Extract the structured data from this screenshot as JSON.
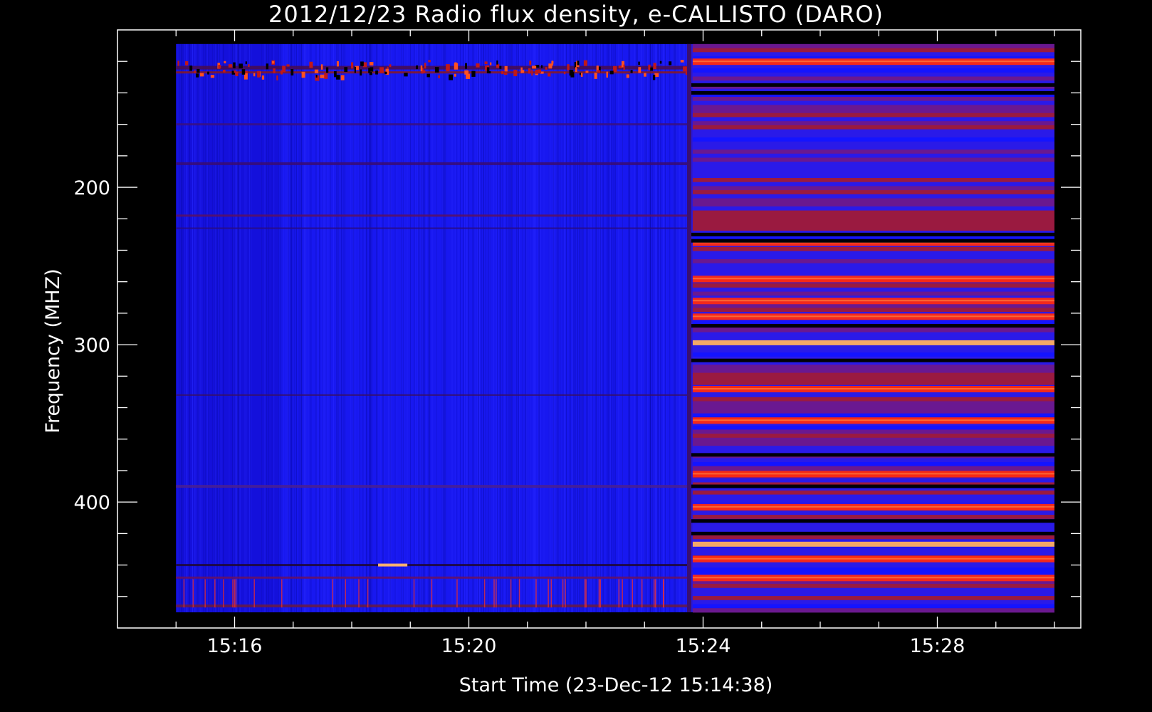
{
  "chart_data": {
    "type": "heatmap",
    "title": "2012/12/23  Radio flux density, e-CALLISTO (DARO)",
    "xlabel": "Start Time (23-Dec-12 15:14:38)",
    "ylabel": "Frequency (MHZ)",
    "x_tick_labels": [
      "15:16",
      "15:20",
      "15:24",
      "15:28"
    ],
    "x_tick_minutes": [
      16,
      20,
      24,
      28
    ],
    "y_tick_labels": [
      "200",
      "300",
      "400"
    ],
    "y_tick_values": [
      200,
      300,
      400
    ],
    "xlim_minutes": [
      14.0,
      30.45
    ],
    "ylim_mhz": [
      100,
      480
    ],
    "data_extent": {
      "time_start_minutes": 15.0,
      "time_end_minutes": 30.0,
      "freq_top_mhz": 109,
      "freq_bottom_mhz": 470
    },
    "event_onset_minutes": 23.75,
    "colormap": [
      "#000000",
      "#1414ff",
      "#7a1a80",
      "#ff2200",
      "#ffd080"
    ],
    "bright_bands_after_onset_mhz": [
      120,
      235,
      258,
      272,
      282,
      299,
      328,
      348,
      382,
      403,
      427,
      436,
      448
    ],
    "dark_bands_after_onset_mhz": [
      135,
      140,
      230,
      234,
      288,
      310,
      370,
      390,
      412,
      420
    ]
  }
}
